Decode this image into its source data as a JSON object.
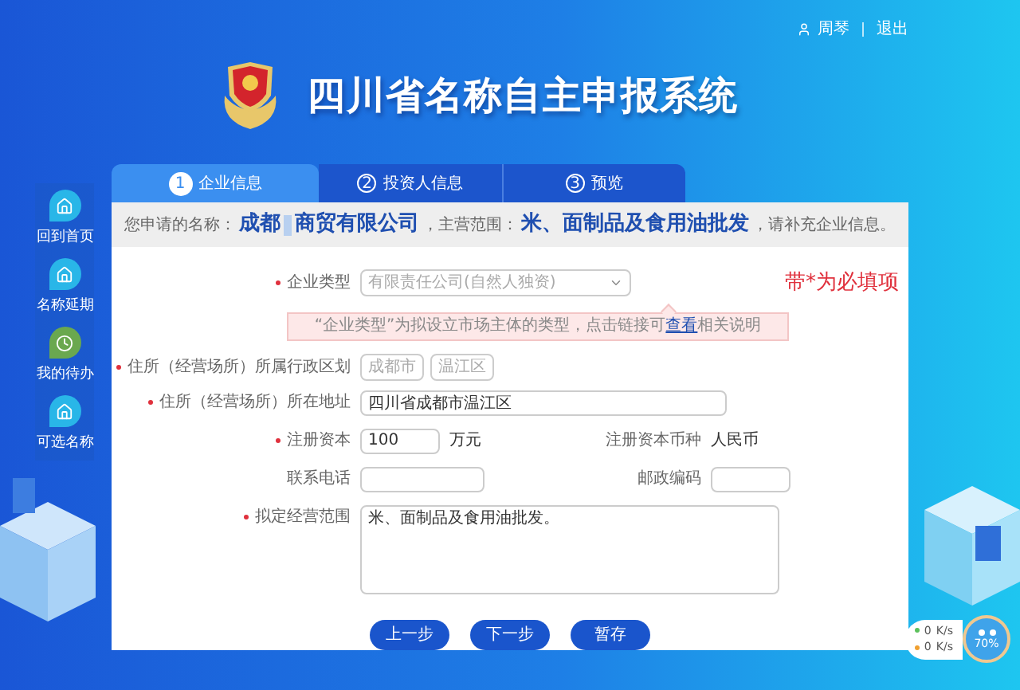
{
  "header": {
    "title": "四川省名称自主申报系统",
    "user": "周琴",
    "logout": "退出"
  },
  "sidebar": {
    "items": [
      {
        "label": "回到首页",
        "kind": "house",
        "color": "#29b6e8"
      },
      {
        "label": "名称延期",
        "kind": "house",
        "color": "#29b6e8"
      },
      {
        "label": "我的待办",
        "kind": "clock",
        "color": "#6aa84f"
      },
      {
        "label": "可选名称",
        "kind": "house",
        "color": "#29b6e8"
      }
    ]
  },
  "steps": [
    {
      "number": "1",
      "label": "企业信息",
      "selected": true
    },
    {
      "number": "2",
      "label": "投资人信息",
      "selected": false
    },
    {
      "number": "3",
      "label": "预览",
      "selected": false
    }
  ],
  "summary": {
    "name_label": "您申请的名称：",
    "name_start": "成都",
    "name_end": "商贸有限公司",
    "scope_label": "，主营范围：",
    "scope": "米、面制品及食用油批发",
    "tail": "，请补充企业信息。"
  },
  "required_note": "带*为必填项",
  "form": {
    "enterprise_type": {
      "label": "企业类型",
      "required": true,
      "placeholder": "有限责任公司(自然人独资)"
    },
    "hint": {
      "text_before": "“企业类型”为拟设立市场主体的类型，点击链接可",
      "link": "查看",
      "text_after": "相关说明"
    },
    "district": {
      "label": "住所（经营场所）所属行政区划",
      "required": true,
      "city": "成都市",
      "district": "温江区"
    },
    "address": {
      "label": "住所（经营场所）所在地址",
      "required": true,
      "value": "四川省成都市温江区"
    },
    "capital": {
      "label": "注册资本",
      "required": true,
      "value": "100",
      "unit": "万元"
    },
    "currency": {
      "label": "注册资本币种",
      "required": false,
      "value": "人民币"
    },
    "phone": {
      "label": "联系电话",
      "required": false
    },
    "postcode": {
      "label": "邮政编码",
      "required": false
    },
    "scope": {
      "label": "拟定经营范围",
      "required": true,
      "value": "米、面制品及食用油批发。"
    }
  },
  "buttons": [
    "上一步",
    "下一步",
    "暂存"
  ],
  "network_widget": {
    "speeds": [
      {
        "value": "0",
        "unit": "K/s",
        "color": "#5cc15c"
      },
      {
        "value": "0",
        "unit": "K/s",
        "color": "#f0a030"
      }
    ],
    "percent": "70%"
  }
}
